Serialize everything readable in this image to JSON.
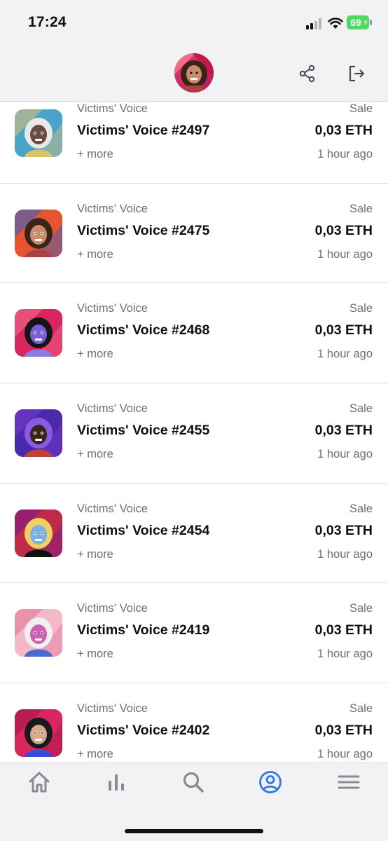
{
  "status_bar": {
    "time": "17:24",
    "battery": "69"
  },
  "header": {
    "avatar": "profile-avatar",
    "share_icon": "share-icon",
    "logout_icon": "logout-icon"
  },
  "list": {
    "items": [
      {
        "collection": "Victims' Voice",
        "title": "Victims' Voice #2497",
        "more": "+ more",
        "event": "Sale",
        "price": "0,03 ETH",
        "time": "1 hour ago",
        "bg": "#4aa3c8",
        "bg2": "#d7c07a",
        "skin": "#6a4a3c",
        "hair": "#e8e8e8",
        "shirt": "#d8c46a"
      },
      {
        "collection": "Victims' Voice",
        "title": "Victims' Voice #2475",
        "more": "+ more",
        "event": "Sale",
        "price": "0,03 ETH",
        "time": "1 hour ago",
        "bg": "#e6552f",
        "bg2": "#3b5fc4",
        "skin": "#c98d6a",
        "hair": "#3a2418",
        "shirt": "#b04040"
      },
      {
        "collection": "Victims' Voice",
        "title": "Victims' Voice #2468",
        "more": "+ more",
        "event": "Sale",
        "price": "0,03 ETH",
        "time": "1 hour ago",
        "bg": "#d8265e",
        "bg2": "#f06a8e",
        "skin": "#7a5cd8",
        "hair": "#151515",
        "shirt": "#8c7ae0"
      },
      {
        "collection": "Victims' Voice",
        "title": "Victims' Voice #2455",
        "more": "+ more",
        "event": "Sale",
        "price": "0,03 ETH",
        "time": "1 hour ago",
        "bg": "#4a2aa8",
        "bg2": "#7a3ad0",
        "skin": "#3a2418",
        "hair": "#8a5ae0",
        "shirt": "#c04040"
      },
      {
        "collection": "Victims' Voice",
        "title": "Victims' Voice #2454",
        "more": "+ more",
        "event": "Sale",
        "price": "0,03 ETH",
        "time": "1 hour ago",
        "bg": "#c02a4a",
        "bg2": "#7a1a8a",
        "skin": "#7ab0e8",
        "hair": "#f0d060",
        "shirt": "#111111"
      },
      {
        "collection": "Victims' Voice",
        "title": "Victims' Voice #2419",
        "more": "+ more",
        "event": "Sale",
        "price": "0,03 ETH",
        "time": "1 hour ago",
        "bg": "#f4b8c6",
        "bg2": "#e07a9a",
        "skin": "#d060b0",
        "hair": "#f0f0f0",
        "shirt": "#4a6ad0"
      },
      {
        "collection": "Victims' Voice",
        "title": "Victims' Voice #2402",
        "more": "+ more",
        "event": "Sale",
        "price": "0,03 ETH",
        "time": "1 hour ago",
        "bg": "#d8265e",
        "bg2": "#a0184a",
        "skin": "#d8a888",
        "hair": "#1a1a1a",
        "shirt": "#3a4ad8"
      }
    ]
  },
  "tab_bar": {
    "tabs": [
      {
        "name": "tab-home",
        "icon": "home-icon",
        "color": "#8a8a90"
      },
      {
        "name": "tab-stats",
        "icon": "bar-chart-icon",
        "color": "#8a8a90"
      },
      {
        "name": "tab-search",
        "icon": "search-icon",
        "color": "#8a8a90"
      },
      {
        "name": "tab-profile",
        "icon": "user-circle-icon",
        "color": "#2f7ae0",
        "active": true
      },
      {
        "name": "tab-menu",
        "icon": "menu-icon",
        "color": "#8a8a90"
      }
    ]
  }
}
